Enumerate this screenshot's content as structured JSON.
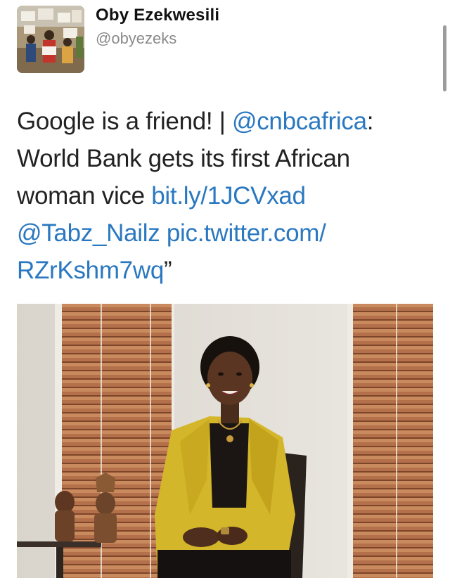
{
  "tweet": {
    "author": {
      "name": "Oby Ezekwesili",
      "handle": "@obyezeks",
      "avatar_icon": "protest-photo-avatar"
    },
    "text": {
      "part1": "Google is a friend! | ",
      "mention1": "@cnbcafrica",
      "part2": ":\nWorld Bank gets its first African\nwoman vice  ",
      "link": "bit.ly/1JCVxad",
      "part3": "\n",
      "mention2": "@Tabz_Nailz",
      "part4": " ",
      "pic_link": "pic.twitter.com/\nRZrKshm7wq",
      "part5": "”"
    },
    "media": {
      "icon": "photo-woman-yellow-blazer"
    }
  },
  "colors": {
    "link": "#2a78c0",
    "text": "#222222",
    "handle": "#8a8a8a"
  }
}
